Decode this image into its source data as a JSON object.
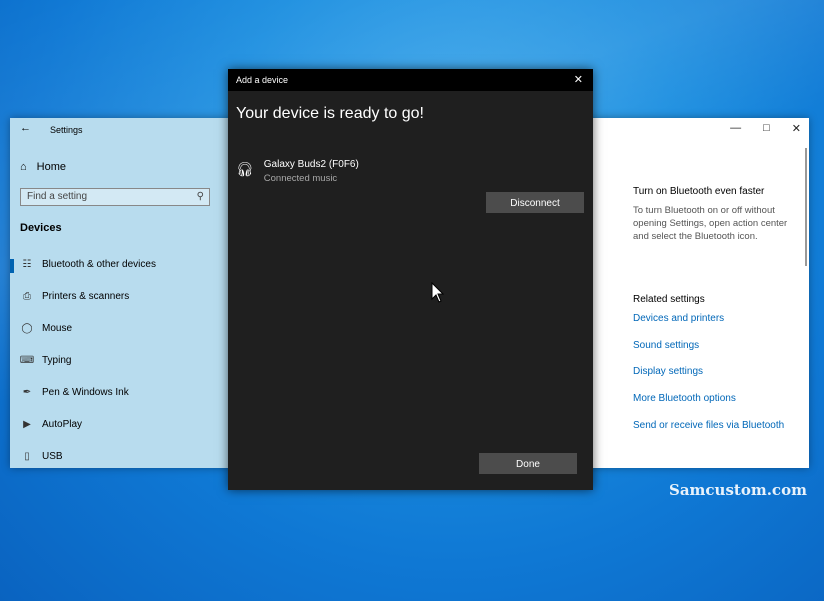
{
  "settings_window": {
    "title": "Settings",
    "back_icon": "back-arrow-icon",
    "home_label": "Home",
    "search_placeholder": "Find a setting",
    "section_heading": "Devices",
    "nav_items": [
      {
        "label": "Bluetooth & other devices",
        "icon": "bluetooth-devices-icon",
        "active": true
      },
      {
        "label": "Printers & scanners",
        "icon": "printer-icon",
        "active": false
      },
      {
        "label": "Mouse",
        "icon": "mouse-icon",
        "active": false
      },
      {
        "label": "Typing",
        "icon": "keyboard-icon",
        "active": false
      },
      {
        "label": "Pen & Windows Ink",
        "icon": "pen-icon",
        "active": false
      },
      {
        "label": "AutoPlay",
        "icon": "autoplay-icon",
        "active": false
      },
      {
        "label": "USB",
        "icon": "usb-icon",
        "active": false
      }
    ],
    "right_pane": {
      "tip_heading": "Turn on Bluetooth even faster",
      "tip_text": "To turn Bluetooth on or off without opening Settings, open action center and select the Bluetooth icon.",
      "related_heading": "Related settings",
      "links": [
        "Devices and printers",
        "Sound settings",
        "Display settings",
        "More Bluetooth options",
        "Send or receive files via Bluetooth"
      ]
    }
  },
  "dialog": {
    "title": "Add a device",
    "heading": "Your device is ready to go!",
    "device": {
      "name": "Galaxy Buds2 (F0F6)",
      "status": "Connected music",
      "icon": "headphones-icon"
    },
    "disconnect_label": "Disconnect",
    "done_label": "Done"
  },
  "watermark": "Samcustom.com",
  "colors": {
    "accent": "#0063b1",
    "link": "#0067b8",
    "dialog_bg": "#1f1f1f",
    "sidebar_bg": "#b8dcee"
  }
}
